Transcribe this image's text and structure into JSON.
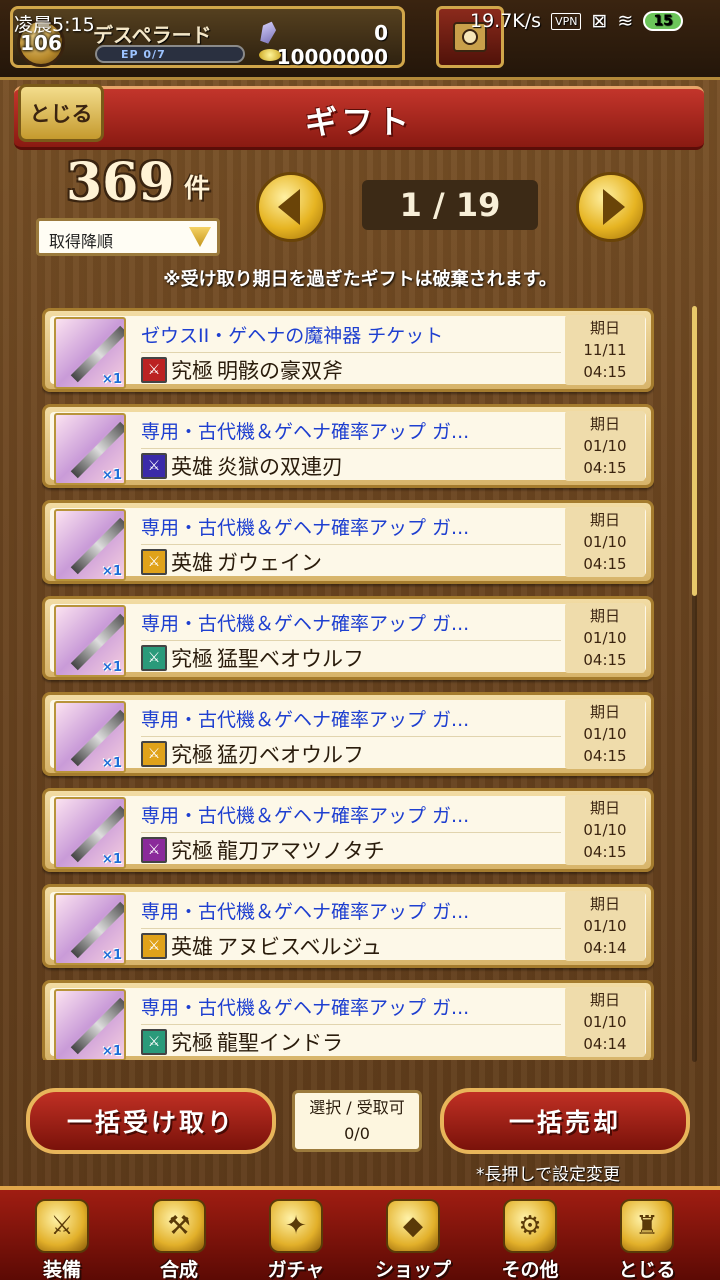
{
  "status": {
    "time": "凌晨5:15",
    "speed": "19.7K/s",
    "vpn": "VPN",
    "battery": "15"
  },
  "player": {
    "level": "106",
    "name": "デスペラード",
    "ep": "EP 0/7",
    "gems": "0",
    "gold": "10000000"
  },
  "header": {
    "close_label": "とじる",
    "title": "ギフト"
  },
  "summary": {
    "count": "369",
    "unit": "件",
    "sort_value": "取得降順",
    "page": "1 / 19",
    "notice": "※受け取り期日を過ぎたギフトは破棄されます。"
  },
  "items": [
    {
      "title": "ゼウスII・ゲヘナの魔神器 チケット",
      "rank": "究極",
      "name": "明骸の豪双斧",
      "icon_color": "#b22",
      "qty": "×1",
      "date_label": "期日",
      "date": "11/11",
      "time": "04:15"
    },
    {
      "title": "専用・古代機＆ゲヘナ確率アップ ガ...",
      "rank": "英雄",
      "name": "炎獄の双連刃",
      "icon_color": "#3a2aa8",
      "qty": "×1",
      "date_label": "期日",
      "date": "01/10",
      "time": "04:15"
    },
    {
      "title": "専用・古代機＆ゲヘナ確率アップ ガ...",
      "rank": "英雄",
      "name": "ガウェイン",
      "icon_color": "#e0a21a",
      "qty": "×1",
      "date_label": "期日",
      "date": "01/10",
      "time": "04:15"
    },
    {
      "title": "専用・古代機＆ゲヘナ確率アップ ガ...",
      "rank": "究極",
      "name": "猛聖ベオウルフ",
      "icon_color": "#2a9a7a",
      "qty": "×1",
      "date_label": "期日",
      "date": "01/10",
      "time": "04:15"
    },
    {
      "title": "専用・古代機＆ゲヘナ確率アップ ガ...",
      "rank": "究極",
      "name": "猛刃ベオウルフ",
      "icon_color": "#e0a21a",
      "qty": "×1",
      "date_label": "期日",
      "date": "01/10",
      "time": "04:15"
    },
    {
      "title": "専用・古代機＆ゲヘナ確率アップ ガ...",
      "rank": "究極",
      "name": "龍刀アマツノタチ",
      "icon_color": "#8a2a9a",
      "qty": "×1",
      "date_label": "期日",
      "date": "01/10",
      "time": "04:15"
    },
    {
      "title": "専用・古代機＆ゲヘナ確率アップ ガ...",
      "rank": "英雄",
      "name": "アヌビスベルジュ",
      "icon_color": "#e0a21a",
      "qty": "×1",
      "date_label": "期日",
      "date": "01/10",
      "time": "04:14"
    },
    {
      "title": "専用・古代機＆ゲヘナ確率アップ ガ...",
      "rank": "究極",
      "name": "龍聖インドラ",
      "icon_color": "#2a9a7a",
      "qty": "×1",
      "date_label": "期日",
      "date": "01/10",
      "time": "04:14"
    }
  ],
  "actions": {
    "bulk_receive": "一括受け取り",
    "select_label": "選択 / 受取可",
    "select_value": "0/0",
    "bulk_sell": "一括売却",
    "hint": "*長押しで設定変更"
  },
  "nav": [
    {
      "label": "装備",
      "icon": "armor-icon",
      "glyph": "⚔"
    },
    {
      "label": "合成",
      "icon": "hammer-icon",
      "glyph": "⚒"
    },
    {
      "label": "ガチャ",
      "icon": "gacha-icon",
      "glyph": "✦"
    },
    {
      "label": "ショップ",
      "icon": "crystal-icon",
      "glyph": "◆"
    },
    {
      "label": "その他",
      "icon": "gear-icon",
      "glyph": "⚙"
    },
    {
      "label": "とじる",
      "icon": "gold-statue-icon",
      "glyph": "♜"
    }
  ]
}
